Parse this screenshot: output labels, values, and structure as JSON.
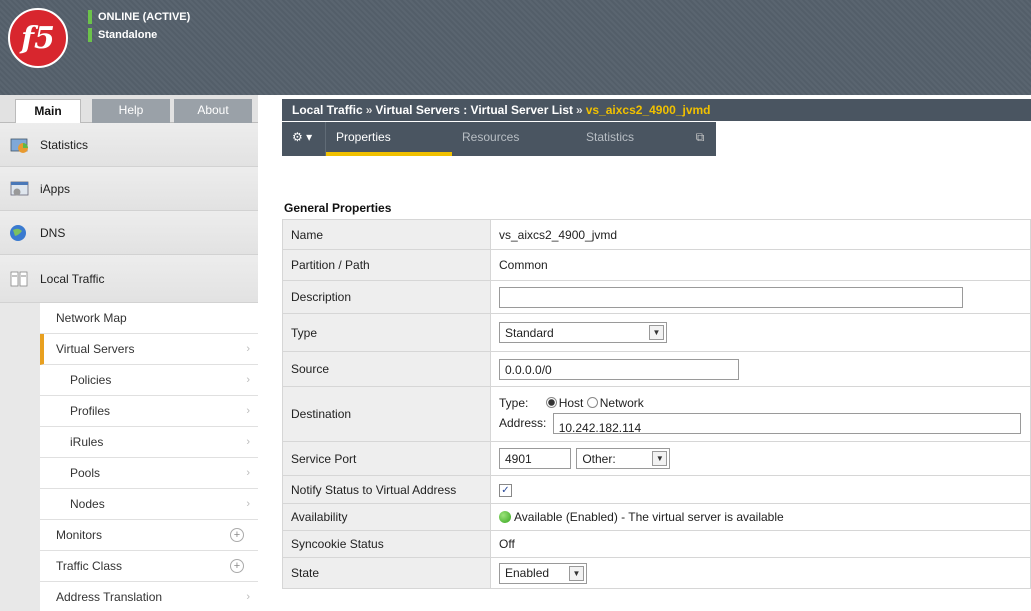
{
  "header": {
    "logo_text": "f5",
    "status_primary": "ONLINE (ACTIVE)",
    "status_secondary": "Standalone"
  },
  "nav": {
    "tabs": [
      "Main",
      "Help",
      "About"
    ],
    "sections": [
      "Statistics",
      "iApps",
      "DNS",
      "Local Traffic"
    ],
    "sub_items": [
      {
        "label": "Network Map"
      },
      {
        "label": "Virtual Servers"
      },
      {
        "label": "Policies"
      },
      {
        "label": "Profiles"
      },
      {
        "label": "iRules"
      },
      {
        "label": "Pools"
      },
      {
        "label": "Nodes"
      },
      {
        "label": "Monitors"
      },
      {
        "label": "Traffic Class"
      },
      {
        "label": "Address Translation"
      }
    ]
  },
  "breadcrumb": {
    "part1": "Local Traffic",
    "sep1": "»",
    "part2": "Virtual Servers : Virtual Server List",
    "sep2": "»",
    "current": "vs_aixcs2_4900_jvmd"
  },
  "tabs": {
    "gear": "⚙ ▾",
    "properties": "Properties",
    "resources": "Resources",
    "statistics": "Statistics",
    "popout": "⧉"
  },
  "section_title": "General Properties",
  "props": {
    "name_label": "Name",
    "name_value": "vs_aixcs2_4900_jvmd",
    "partition_label": "Partition / Path",
    "partition_value": "Common",
    "description_label": "Description",
    "description_value": "",
    "type_label": "Type",
    "type_value": "Standard",
    "source_label": "Source",
    "source_value": "0.0.0.0/0",
    "destination_label": "Destination",
    "dest_type_label": "Type:",
    "dest_host_label": "Host",
    "dest_network_label": "Network",
    "dest_address_label": "Address:",
    "dest_address_value": "10.242.182.114",
    "service_port_label": "Service Port",
    "service_port_value": "4901",
    "service_port_select": "Other:",
    "notify_label": "Notify Status to Virtual Address",
    "notify_checked": true,
    "availability_label": "Availability",
    "availability_value": "Available (Enabled) - The virtual server is available",
    "syncookie_label": "Syncookie Status",
    "syncookie_value": "Off",
    "state_label": "State",
    "state_value": "Enabled"
  }
}
